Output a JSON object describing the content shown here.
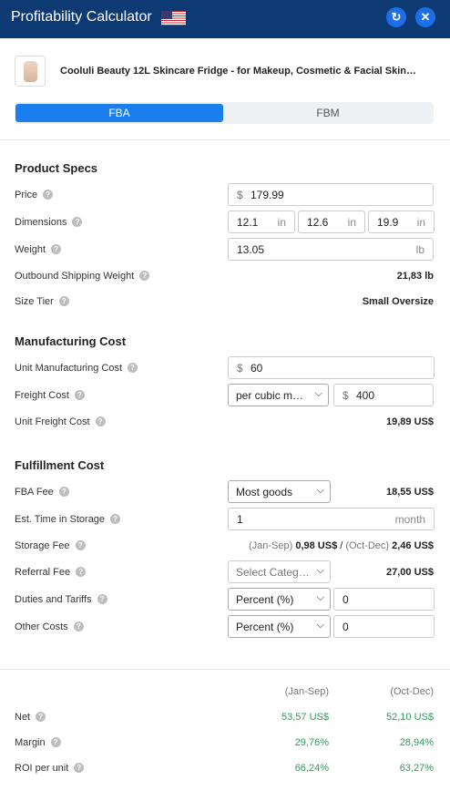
{
  "header": {
    "title": "Profitability Calculator",
    "flag": "us-flag-icon"
  },
  "product": {
    "title": "Cooluli Beauty 12L Skincare Fridge - for Makeup, Cosmetic & Facial Skin…"
  },
  "tabs": [
    {
      "label": "FBA"
    },
    {
      "label": "FBM"
    }
  ],
  "product_specs": {
    "title": "Product Specs",
    "price": {
      "label": "Price",
      "currency": "$",
      "value": "179.99"
    },
    "dimensions": {
      "label": "Dimensions",
      "l": "12.1",
      "w": "12.6",
      "h": "19.9",
      "unit": "in"
    },
    "weight": {
      "label": "Weight",
      "value": "13.05",
      "unit": "lb"
    },
    "outbound": {
      "label": "Outbound Shipping Weight",
      "value": "21,83 lb"
    },
    "size_tier": {
      "label": "Size Tier",
      "value": "Small Oversize"
    }
  },
  "manufacturing": {
    "title": "Manufacturing Cost",
    "unit_cost": {
      "label": "Unit Manufacturing Cost",
      "currency": "$",
      "value": "60"
    },
    "freight": {
      "label": "Freight Cost",
      "mode": "per cubic m…",
      "currency": "$",
      "value": "400"
    },
    "unit_freight": {
      "label": "Unit Freight Cost",
      "value": "19,89 US$"
    }
  },
  "fulfillment": {
    "title": "Fulfillment Cost",
    "fba_fee": {
      "label": "FBA Fee",
      "option": "Most goods",
      "value": "18,55 US$"
    },
    "time_storage": {
      "label": "Est. Time in Storage",
      "value": "1",
      "unit": "month"
    },
    "storage_fee": {
      "label": "Storage Fee",
      "p1": "(Jan-Sep)",
      "v1": "0,98 US$",
      "sep": " / ",
      "p2": "(Oct-Dec)",
      "v2": "2,46 US$"
    },
    "referral": {
      "label": "Referral Fee",
      "placeholder": "Select Categ…",
      "value": "27,00 US$"
    },
    "duties": {
      "label": "Duties and Tariffs",
      "option": "Percent (%)",
      "value": "0"
    },
    "other": {
      "label": "Other Costs",
      "option": "Percent (%)",
      "value": "0"
    }
  },
  "results": {
    "col1": "(Jan-Sep)",
    "col2": "(Oct-Dec)",
    "rows": [
      {
        "label": "Net",
        "v1": "53,57 US$",
        "v2": "52,10 US$"
      },
      {
        "label": "Margin",
        "v1": "29,76%",
        "v2": "28,94%"
      },
      {
        "label": "ROI per unit",
        "v1": "66,24%",
        "v2": "63,27%"
      }
    ]
  },
  "colors": {
    "header": "#0d3a72",
    "accent": "#1a7eef",
    "positive": "#2a9d5c"
  }
}
